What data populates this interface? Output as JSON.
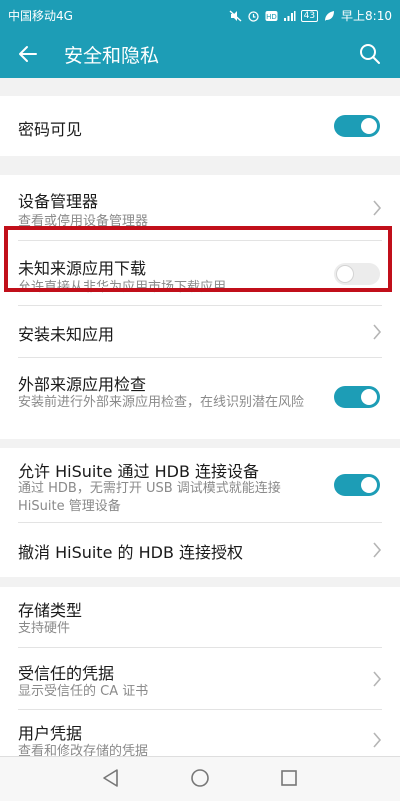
{
  "status_bar": {
    "carrier": "中国移动4G",
    "battery": "43",
    "time": "早上8:10",
    "icons": [
      "mute-icon",
      "alarm-icon",
      "hd-icon",
      "signal-icon",
      "battery-icon",
      "leaf-icon"
    ]
  },
  "app_bar": {
    "title": "安全和隐私",
    "icons": [
      "back-arrow-icon",
      "search-icon"
    ]
  },
  "settings": [
    {
      "title": "密码可见",
      "toggle": true
    },
    {
      "title": "设备管理器",
      "subtitle": "查看或停用设备管理器",
      "chevron": true
    },
    {
      "title": "未知来源应用下载",
      "subtitle": "允许直接从非华为应用市场下载应用",
      "toggle": false,
      "highlighted": true
    },
    {
      "title": "安装未知应用",
      "chevron": true
    },
    {
      "title": "外部来源应用检查",
      "subtitle": "安装前进行外部来源应用检查，在线识别潜在风险",
      "toggle": true
    },
    {
      "title": "允许 HiSuite 通过 HDB 连接设备",
      "subtitle": "通过 HDB，无需打开 USB 调试模式就能连接 HiSuite 管理设备",
      "toggle": true
    },
    {
      "title": "撤消 HiSuite 的 HDB 连接授权",
      "chevron": true
    },
    {
      "title": "存储类型",
      "subtitle": "支持硬件"
    },
    {
      "title": "受信任的凭据",
      "subtitle": "显示受信任的 CA 证书",
      "chevron": true
    },
    {
      "title": "用户凭据",
      "subtitle": "查看和修改存储的凭据",
      "chevron": true
    }
  ],
  "nav_bar": {
    "icons": [
      "back-triangle-icon",
      "home-circle-icon",
      "recents-square-icon"
    ]
  },
  "colors": {
    "accent": "#1d9db6",
    "highlight_border": "#c10f1a"
  }
}
